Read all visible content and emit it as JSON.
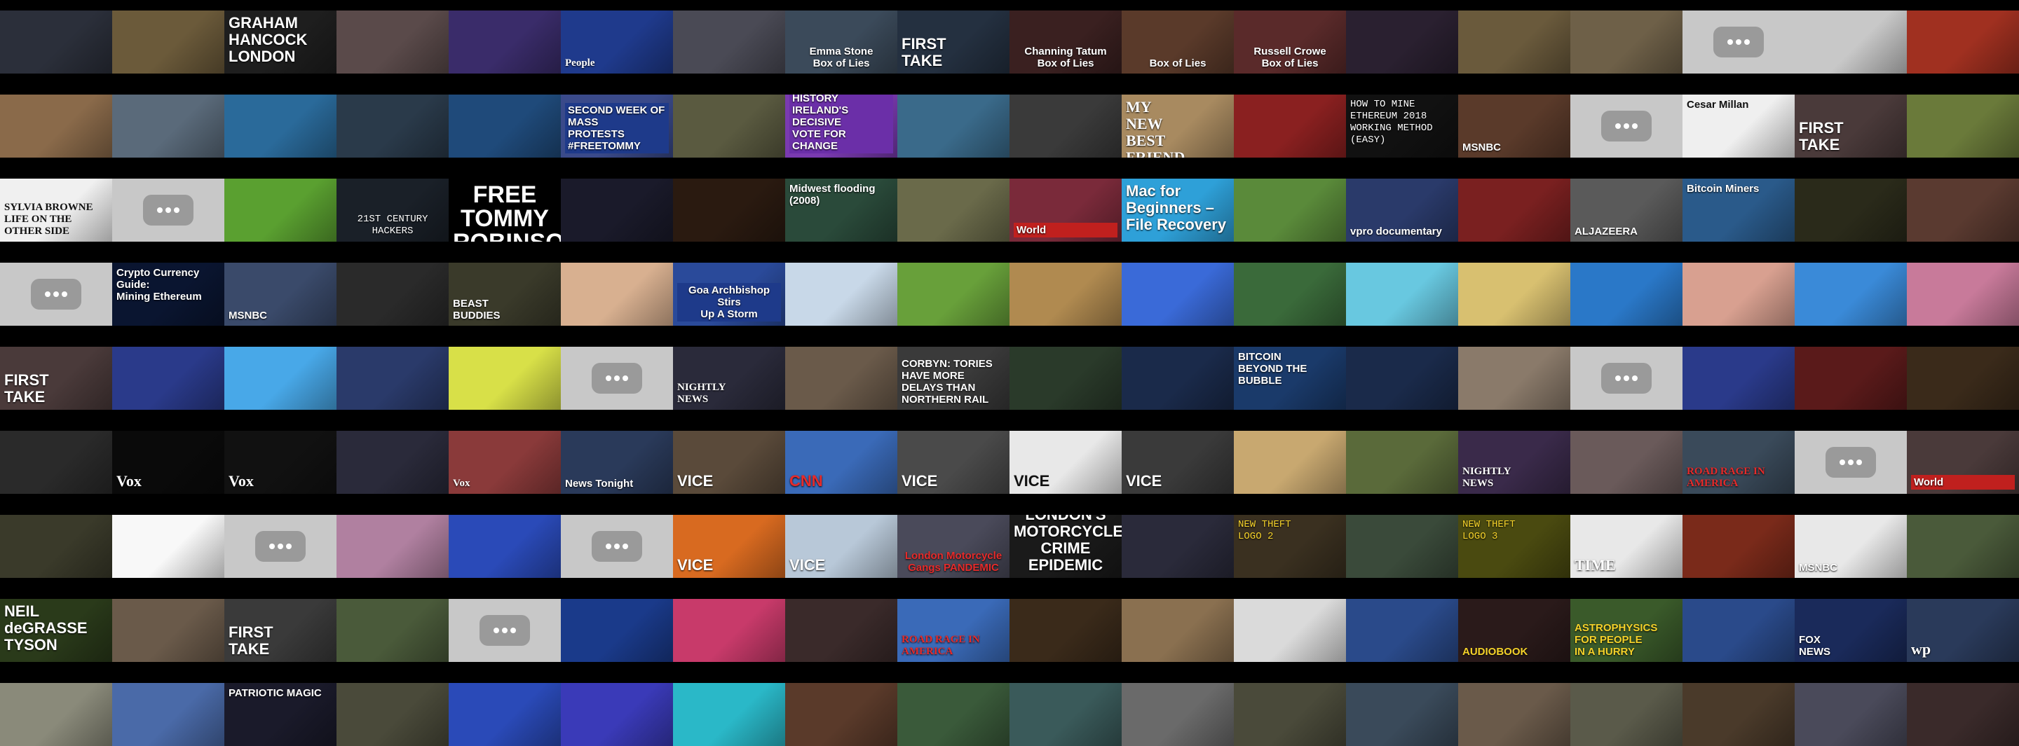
{
  "grid": {
    "columns": 18,
    "rows": 9,
    "cells": [
      [
        "",
        "",
        "GRAHAM\nHANCOCK\nLONDON",
        "",
        "",
        "People",
        "",
        "Emma Stone\nBox of Lies",
        "FIRST\nTAKE",
        "Channing Tatum\nBox of Lies",
        "Box of Lies",
        "Russell Crowe\nBox of Lies",
        "",
        "",
        "",
        "",
        "",
        ""
      ],
      [
        "",
        "",
        "",
        "",
        "",
        "SECOND WEEK OF MASS\nPROTESTS #FREETOMMY",
        "",
        "WE MADE\nHISTORY\nIRELAND'S DECISIVE\nVOTE FOR CHANGE",
        "",
        "",
        "MY\nNEW\nBEST\nFRIEND",
        "",
        "HOW TO MINE ETHEREUM 2018\nWORKING METHOD\n(EASY)",
        "MSNBC",
        "",
        "Cesar Millan",
        "FIRST\nTAKE",
        ""
      ],
      [
        "SYLVIA BROWNE\nLIFE ON THE OTHER SIDE",
        "",
        "",
        "21ST CENTURY\nHACKERS",
        "FREE\nTOMMY\nROBINSON!",
        "",
        "",
        "Midwest flooding (2008)",
        "",
        "World",
        "Mac for\nBeginners –\nFile Recovery",
        "",
        "vpro documentary",
        "",
        "ALJAZEERA",
        "Bitcoin Miners",
        "",
        ""
      ],
      [
        "",
        "Crypto Currency Guide:\nMining Ethereum",
        "MSNBC",
        "",
        "BEAST\nBUDDIES",
        "",
        "Goa Archbishop Stirs\nUp A Storm",
        "",
        "",
        "",
        "",
        "",
        "",
        "",
        "",
        "",
        "",
        ""
      ],
      [
        "FIRST\nTAKE",
        "",
        "",
        "",
        "",
        "",
        "NIGHTLY\nNEWS",
        "",
        "CORBYN: TORIES HAVE MORE\nDELAYS THAN NORTHERN RAIL",
        "",
        "",
        "BITCOIN\nBEYOND THE BUBBLE",
        "",
        "",
        "",
        "",
        "",
        ""
      ],
      [
        "",
        "Vox",
        "Vox",
        "",
        "Vox",
        "News Tonight",
        "VICE",
        "CNN",
        "VICE",
        "VICE",
        "VICE",
        "",
        "",
        "NIGHTLY\nNEWS",
        "",
        "ROAD RAGE IN AMERICA",
        "",
        "World"
      ],
      [
        "",
        "",
        "",
        "",
        "",
        "",
        "VICE",
        "VICE",
        "London Motorcycle\nGangs PANDEMIC",
        "LONDON'S\nMOTORCYCLE\nCRIME\nEPIDEMIC",
        "",
        "NEW THEFT\nLOGO 2",
        "",
        "NEW THEFT\nLOGO 3",
        "TIME",
        "",
        "MSNBC",
        ""
      ],
      [
        "NEIL\ndeGRASSE\nTYSON",
        "",
        "FIRST\nTAKE",
        "",
        "",
        "",
        "",
        "",
        "ROAD RAGE IN AMERICA",
        "",
        "",
        "",
        "",
        "AUDIOBOOK",
        "ASTROPHYSICS\nFOR PEOPLE\nIN A HURRY",
        "",
        "FOX\nNEWS",
        "wp"
      ],
      [
        "",
        "",
        "PATRIOTIC MAGIC",
        "",
        "",
        "",
        "",
        "",
        "",
        "",
        "",
        "",
        "",
        "",
        "",
        "",
        "",
        ""
      ]
    ]
  }
}
